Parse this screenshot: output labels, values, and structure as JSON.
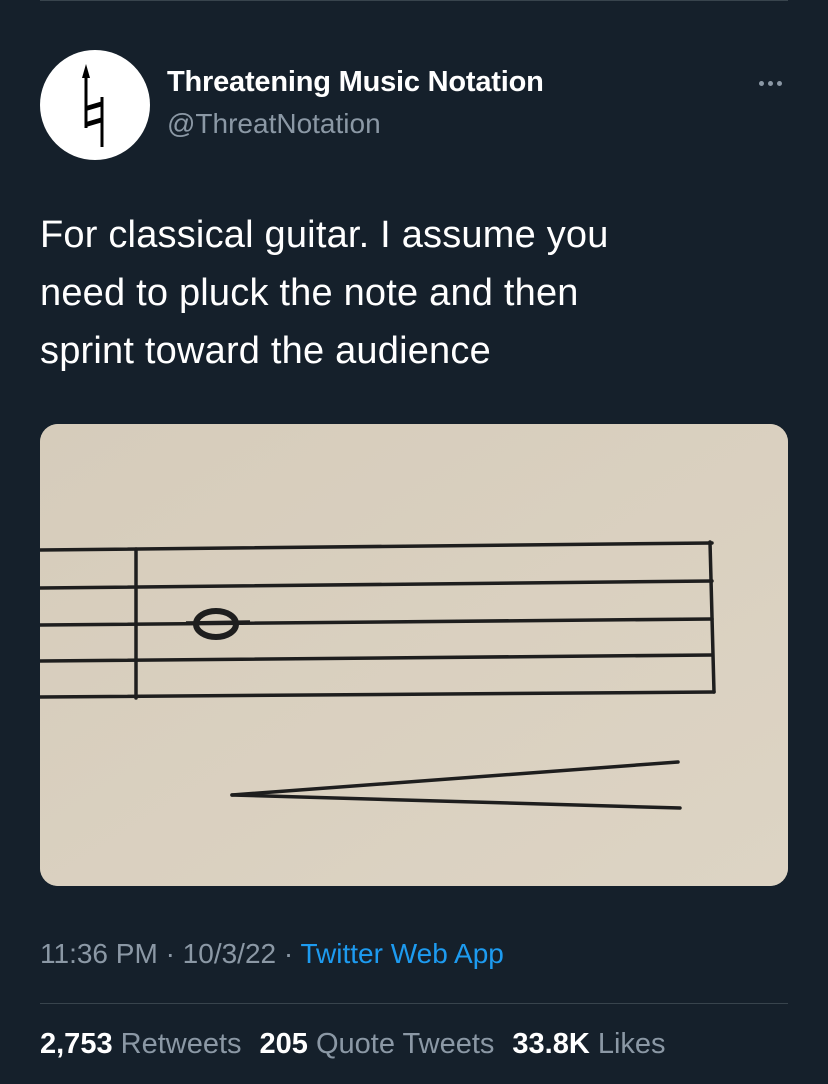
{
  "author": {
    "display_name": "Threatening Music Notation",
    "handle": "@ThreatNotation",
    "avatar_icon": "natural-sign-arrow-icon"
  },
  "menu": {
    "more_icon": "more-horizontal-icon"
  },
  "tweet": {
    "text_lines": [
      "For classical guitar. I assume you",
      "need to pluck the note and then",
      "sprint toward the audience"
    ],
    "media_icon": "music-staff-whole-note-crescendo-image"
  },
  "meta": {
    "time": "11:36 PM",
    "sep1": "·",
    "date": "10/3/22",
    "sep2": "·",
    "source": "Twitter Web App"
  },
  "stats": {
    "retweets": {
      "count": "2,753",
      "label": "Retweets"
    },
    "quotes": {
      "count": "205",
      "label": "Quote Tweets"
    },
    "likes": {
      "count": "33.8K",
      "label": "Likes"
    }
  },
  "colors": {
    "background": "#15202b",
    "secondary_text": "#8b98a5",
    "link": "#1d9bf0",
    "divider": "#38444d"
  }
}
